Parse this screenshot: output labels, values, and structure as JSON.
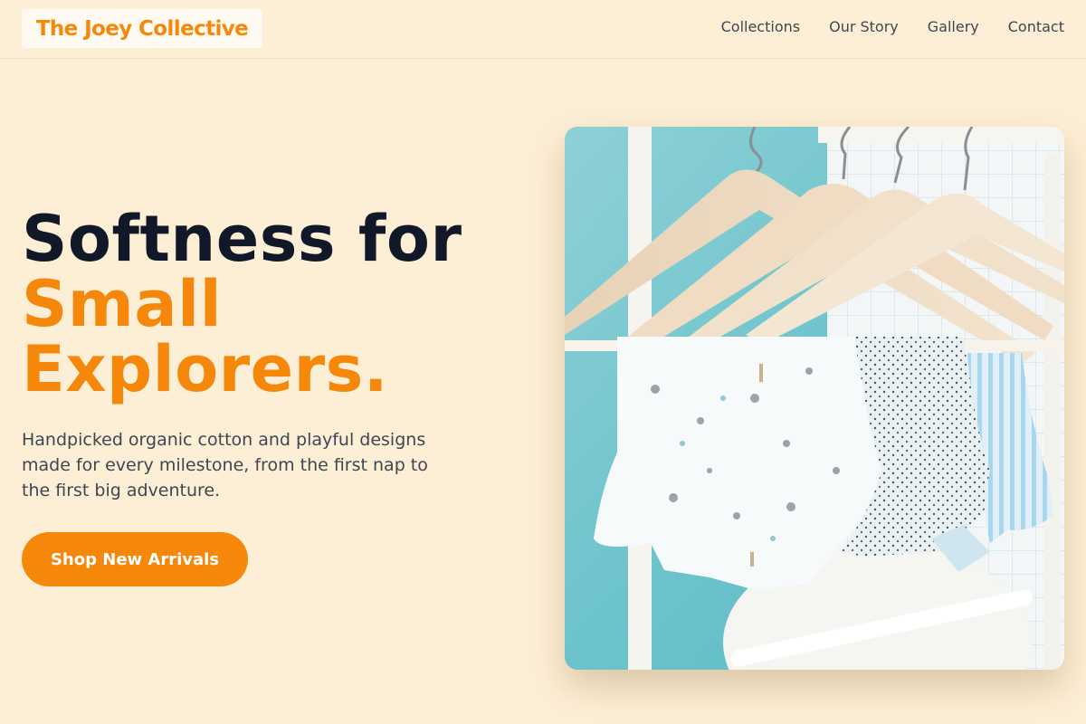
{
  "brand": {
    "name": "The Joey Collective"
  },
  "nav": {
    "items": [
      {
        "label": "Collections"
      },
      {
        "label": "Our Story"
      },
      {
        "label": "Gallery"
      },
      {
        "label": "Contact"
      }
    ]
  },
  "hero": {
    "headline_line1": "Softness for",
    "headline_line2": "Small",
    "headline_line3": "Explorers.",
    "description": "Handpicked organic cotton and playful designs made for every milestone, from the first nap to the first big adventure.",
    "cta_label": "Shop New Arrivals"
  },
  "colors": {
    "background": "#fdefd6",
    "accent": "#f5880a",
    "heading": "#111827",
    "body_text": "#3f4652"
  },
  "image": {
    "subject": "baby clothes on wooden hangers"
  }
}
